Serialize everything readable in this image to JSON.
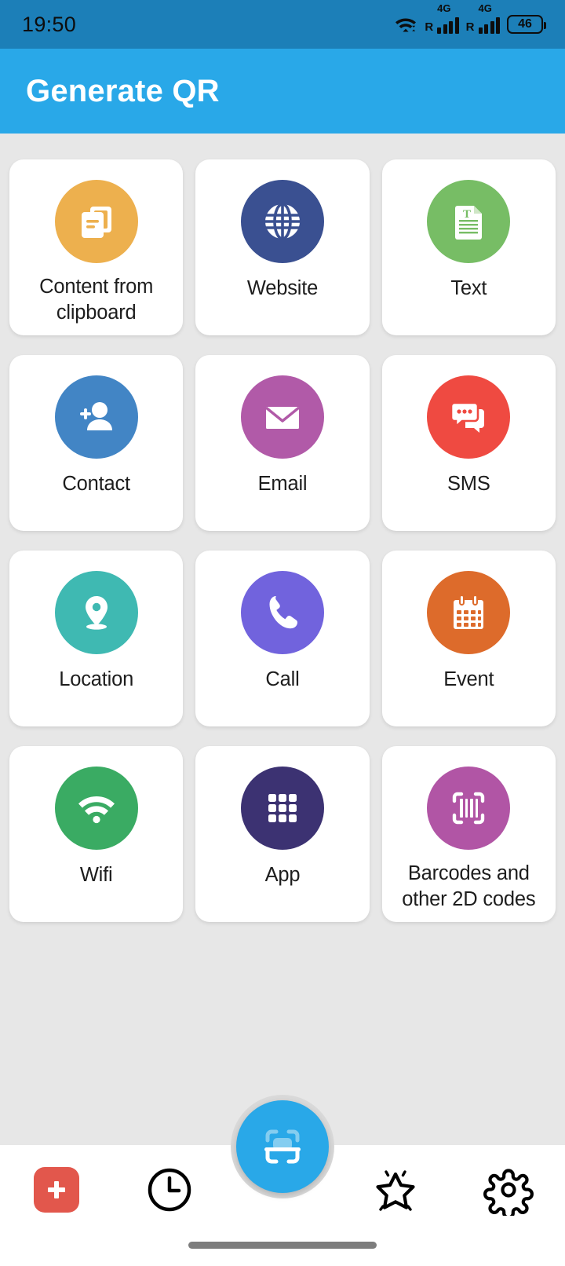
{
  "status_bar": {
    "time": "19:50",
    "wifi_icon": "wifi-icon",
    "sim1": {
      "network_label": "4G",
      "roaming_label": "R",
      "bars": 4
    },
    "sim2": {
      "network_label": "4G",
      "roaming_label": "R",
      "bars": 4
    },
    "battery_level": "46"
  },
  "app_bar": {
    "title": "Generate QR",
    "background_color": "#29a8e8"
  },
  "colors": {
    "status_bar_bg": "#1c7fb8",
    "page_bg": "#e7e7e7",
    "card_bg": "#ffffff",
    "accent": "#29a8e8",
    "add_button": "#e2574c"
  },
  "grid": {
    "items": [
      {
        "label": "Content from clipboard",
        "icon": "copy-documents-icon",
        "color": "#edb04e",
        "two_line": true
      },
      {
        "label": "Website",
        "icon": "globe-icon",
        "color": "#3a5091",
        "two_line": false
      },
      {
        "label": "Text",
        "icon": "text-document-icon",
        "color": "#77bd65",
        "two_line": false
      },
      {
        "label": "Contact",
        "icon": "add-person-icon",
        "color": "#4285c5",
        "two_line": false
      },
      {
        "label": "Email",
        "icon": "envelope-icon",
        "color": "#b15aa8",
        "two_line": false
      },
      {
        "label": "SMS",
        "icon": "chat-bubbles-icon",
        "color": "#ef4a41",
        "two_line": false
      },
      {
        "label": "Location",
        "icon": "map-pin-icon",
        "color": "#3fb9b2",
        "two_line": false
      },
      {
        "label": "Call",
        "icon": "phone-icon",
        "color": "#7163dd",
        "two_line": false
      },
      {
        "label": "Event",
        "icon": "calendar-icon",
        "color": "#dd6b2b",
        "two_line": false
      },
      {
        "label": "Wifi",
        "icon": "wifi-signal-icon",
        "color": "#3aab63",
        "two_line": false
      },
      {
        "label": "App",
        "icon": "app-grid-icon",
        "color": "#3c3272",
        "two_line": false
      },
      {
        "label": "Barcodes and other 2D codes",
        "icon": "barcode-scan-icon",
        "color": "#b155a5",
        "two_line": true
      }
    ]
  },
  "bottom_nav": {
    "items": [
      {
        "name": "add",
        "icon": "plus-icon"
      },
      {
        "name": "history",
        "icon": "clock-icon"
      },
      {
        "name": "scan",
        "icon": "scan-qr-icon"
      },
      {
        "name": "favorites",
        "icon": "star-icon"
      },
      {
        "name": "settings",
        "icon": "gear-icon"
      }
    ]
  }
}
